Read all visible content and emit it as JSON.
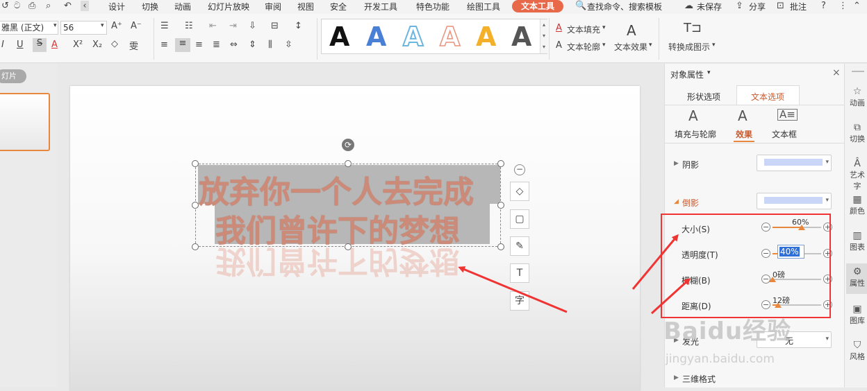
{
  "menu": {
    "items": [
      "设计",
      "切换",
      "动画",
      "幻灯片放映",
      "审阅",
      "视图",
      "安全",
      "开发工具",
      "特色功能",
      "绘图工具",
      "文本工具"
    ],
    "search": "查找命令、搜索模板",
    "unsaved": "未保存",
    "share": "分享",
    "comment": "批注"
  },
  "ribbon": {
    "font_name": "雅黑 (正文)",
    "font_size": "56",
    "text_fill": "文本填充",
    "text_outline": "文本轮廓",
    "text_effect": "文本效果",
    "convert_to_graphic": "转换成图示",
    "style_letter": "A",
    "colors": {
      "accent": "#e8694a"
    }
  },
  "thumbnails": {
    "label": "灯片"
  },
  "slide": {
    "line1": "放弃你一个人去完成",
    "line2": "我们曾许下的梦想",
    "reflection": "我们曾许下的梦想"
  },
  "panel": {
    "title": "对象属性",
    "tabs": [
      "形状选项",
      "文本选项"
    ],
    "subtabs": [
      "填充与轮廓",
      "效果",
      "文本框"
    ],
    "shadow": "阴影",
    "reflection": "倒影",
    "size": {
      "label": "大小(S)",
      "value": "60%",
      "fraction": 0.6
    },
    "transparency": {
      "label": "透明度(T)",
      "value": "40%",
      "fraction": 0.4
    },
    "blur": {
      "label": "模糊(B)",
      "value": "0磅",
      "fraction": 0.0
    },
    "distance": {
      "label": "距离(D)",
      "value": "12磅",
      "fraction": 0.12
    },
    "glow_label": "发光",
    "glow_value": "无",
    "three_d": "三维格式"
  },
  "rail": [
    "动画",
    "切换",
    "艺术字",
    "颜色",
    "图表",
    "属性",
    "图库",
    "风格"
  ],
  "watermark": {
    "brand": "Baidu经验",
    "url": "jingyan.baidu.com"
  }
}
